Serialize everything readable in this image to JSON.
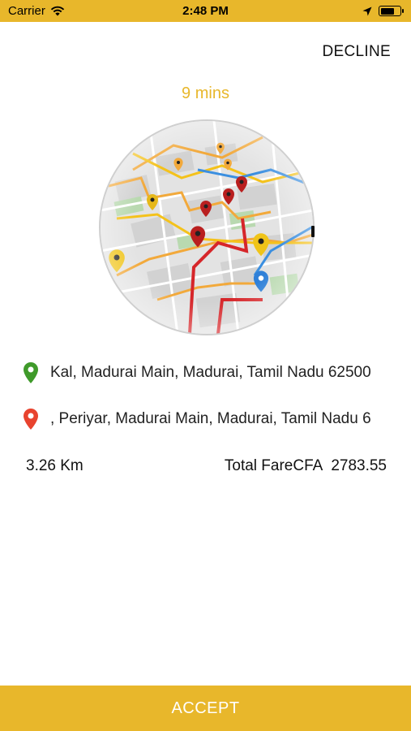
{
  "status_bar": {
    "carrier": "Carrier",
    "time": "2:48 PM"
  },
  "header": {
    "decline_label": "DECLINE"
  },
  "eta": {
    "text": "9 mins"
  },
  "pickup": {
    "address": "Kal, Madurai Main, Madurai, Tamil Nadu 62500",
    "pin_color": "#3f9a2a"
  },
  "drop": {
    "address": ", Periyar, Madurai Main, Madurai, Tamil Nadu 6",
    "pin_color": "#e8432e"
  },
  "trip": {
    "distance": "3.26 Km",
    "fare_label": "Total FareCFA",
    "fare_value": "2783.55"
  },
  "footer": {
    "accept_label": "ACCEPT"
  },
  "colors": {
    "accent": "#e8b72b",
    "text": "#111111"
  }
}
